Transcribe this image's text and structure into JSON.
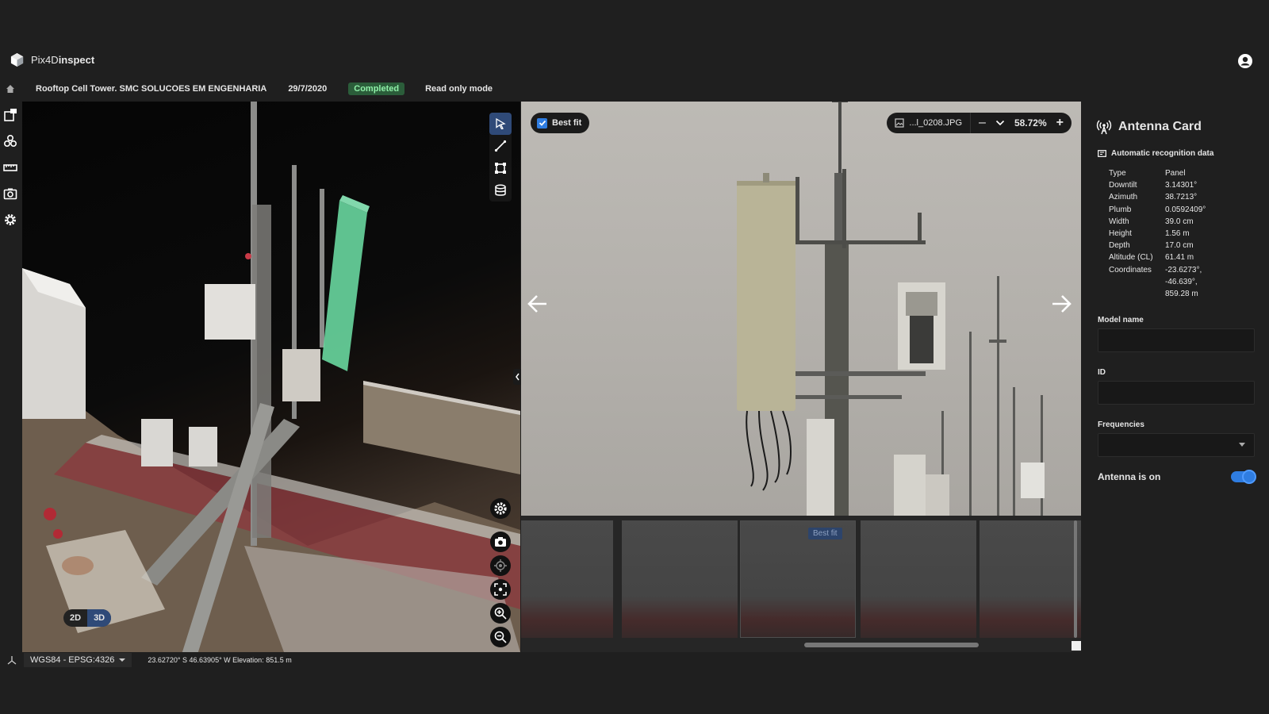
{
  "app": {
    "brand_prefix": "Pix4D",
    "brand_bold": "inspect"
  },
  "project": {
    "title": "Rooftop Cell Tower. SMC SOLUCOES EM ENGENHARIA",
    "date": "29/7/2020",
    "status": "Completed",
    "mode": "Read only mode"
  },
  "viewer3d": {
    "toggle_2d": "2D",
    "toggle_3d": "3D",
    "active_mode": "3D"
  },
  "image_viewer": {
    "best_fit_label": "Best fit",
    "best_fit_checked": true,
    "filename": "...l_0208.JPG",
    "zoom": "58.72%",
    "zoom_minus": "–",
    "zoom_plus": "+"
  },
  "filmstrip": {
    "selected_badge": "Best fit"
  },
  "antenna_card": {
    "title": "Antenna Card",
    "subtitle": "Automatic recognition data",
    "properties": [
      {
        "k": "Type",
        "v": "Panel"
      },
      {
        "k": "Downtilt",
        "v": "3.14301°"
      },
      {
        "k": "Azimuth",
        "v": "38.7213°"
      },
      {
        "k": "Plumb",
        "v": "0.0592409°"
      },
      {
        "k": "Width",
        "v": "39.0 cm"
      },
      {
        "k": "Height",
        "v": "1.56 m"
      },
      {
        "k": "Depth",
        "v": "17.0 cm"
      },
      {
        "k": "Altitude (CL)",
        "v": "61.41 m"
      },
      {
        "k": "Coordinates",
        "v": "-23.6273°,"
      },
      {
        "k": "",
        "v": "-46.639°,"
      },
      {
        "k": "",
        "v": "859.28 m"
      }
    ],
    "model_name_label": "Model name",
    "model_name_value": "",
    "id_label": "ID",
    "id_value": "",
    "frequencies_label": "Frequencies",
    "frequencies_value": "",
    "toggle_label": "Antenna is on",
    "toggle_on": true
  },
  "statusbar": {
    "crs": "WGS84 - EPSG:4326",
    "coords": "23.62720° S 46.63905° W   Elevation: 851.5 m"
  },
  "colors": {
    "accent": "#2f7de1",
    "active_tool": "#2f4a78",
    "status_bg": "#2b5d3a",
    "status_text": "#8ff0a8",
    "highlight_antenna": "#6ee3a8"
  }
}
